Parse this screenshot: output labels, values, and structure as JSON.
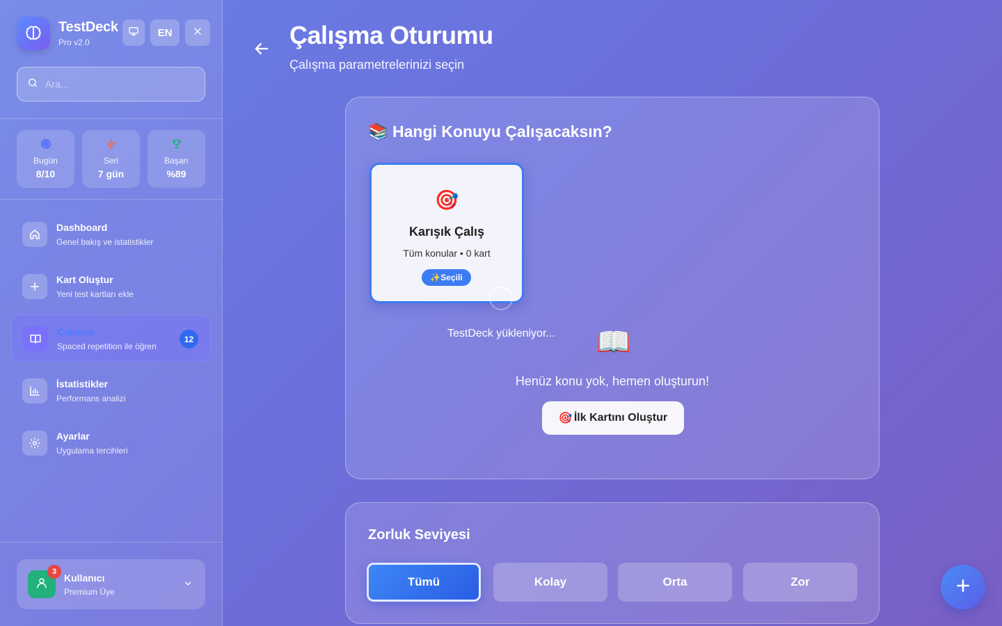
{
  "sidebar": {
    "brand": {
      "title": "TestDeck",
      "subtitle": "Pro v2.0",
      "logo_icon": "brain-icon"
    },
    "top_buttons": {
      "monitor_icon": "monitor-icon",
      "language": "EN",
      "close_icon": "close-icon"
    },
    "search": {
      "placeholder": "Ara..."
    },
    "stats": [
      {
        "label": "Bugün",
        "value": "8/10",
        "icon": "target-icon",
        "color": "#3f63ff"
      },
      {
        "label": "Seri",
        "value": "7 gün",
        "icon": "zap-icon",
        "color": "#ef6b4a"
      },
      {
        "label": "Başarı",
        "value": "%89",
        "icon": "trophy-icon",
        "color": "#1fb079"
      }
    ],
    "nav": [
      {
        "title": "Dashboard",
        "desc": "Genel bakış ve istatistikler",
        "icon": "home-icon"
      },
      {
        "title": "Kart Oluştur",
        "desc": "Yeni test kartları ekle",
        "icon": "plus-icon"
      },
      {
        "title": "Çalışma",
        "desc": "Spaced repetition ile öğren",
        "icon": "book-icon",
        "badge": "12",
        "active": true
      },
      {
        "title": "İstatistikler",
        "desc": "Performans analizi",
        "icon": "bar-chart-icon"
      },
      {
        "title": "Ayarlar",
        "desc": "Uygulama tercihleri",
        "icon": "settings-icon"
      }
    ],
    "user": {
      "name": "Kullanıcı",
      "role": "Premium Üye",
      "notifications": "3"
    }
  },
  "header": {
    "title": "Çalışma Oturumu",
    "subtitle": "Çalışma parametrelerinizi seçin"
  },
  "topic_panel": {
    "title": "Hangi Konuyu Çalışacaksın?",
    "title_emoji": "📚",
    "card": {
      "emoji": "🎯",
      "title": "Karışık Çalış",
      "subtitle": "Tüm konular • 0 kart",
      "chip": "✨Seçili"
    },
    "loading_text": "TestDeck yükleniyor...",
    "empty_emoji": "📖",
    "empty_message": "Henüz konu yok, hemen oluşturun!",
    "create_button": {
      "emoji": "🎯",
      "label": "İlk Kartını Oluştur"
    }
  },
  "difficulty_panel": {
    "title": "Zorluk Seviyesi",
    "options": [
      "Tümü",
      "Kolay",
      "Orta",
      "Zor"
    ],
    "selected": "Tümü"
  },
  "colors": {
    "accent": "#3d7bf2",
    "badge": "#2f6af0",
    "notification": "#e84545",
    "avatar": "#22b07d"
  }
}
